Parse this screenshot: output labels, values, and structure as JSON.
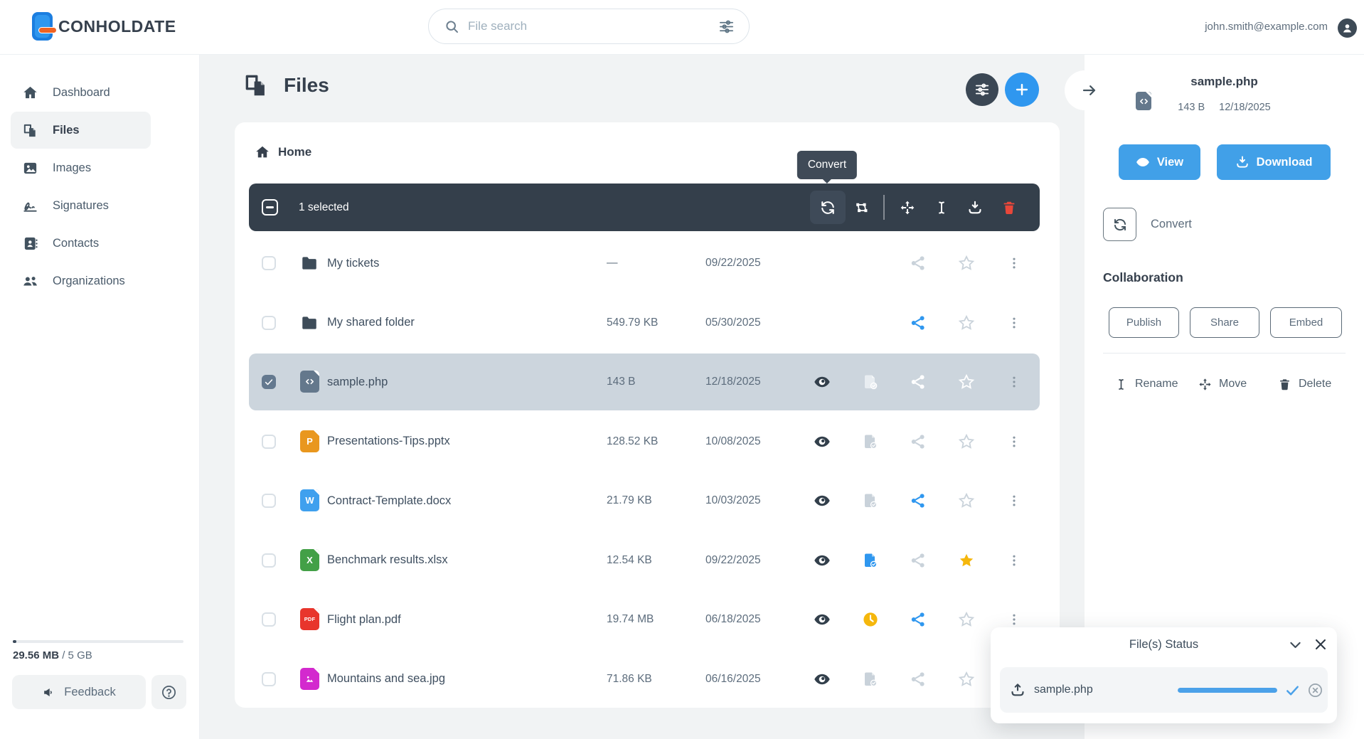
{
  "topbar": {
    "logo_text": "CONHOLDATE",
    "search_placeholder": "File search",
    "user_email": "john.smith@example.com"
  },
  "sidebar": {
    "items": [
      {
        "label": "Dashboard",
        "icon": "home",
        "active": false
      },
      {
        "label": "Files",
        "icon": "files",
        "active": true
      },
      {
        "label": "Images",
        "icon": "image",
        "active": false
      },
      {
        "label": "Signatures",
        "icon": "signature",
        "active": false
      },
      {
        "label": "Contacts",
        "icon": "contacts",
        "active": false
      },
      {
        "label": "Organizations",
        "icon": "organizations",
        "active": false
      }
    ],
    "storage": {
      "used": "29.56 MB",
      "total": "/ 5 GB",
      "used_percent": 2
    },
    "feedback_label": "Feedback"
  },
  "main": {
    "title": "Files",
    "breadcrumb": "Home",
    "toolbar": {
      "selected_text": "1 selected",
      "tooltip": "Convert",
      "icons": [
        "convert",
        "merge",
        "move",
        "rename",
        "download",
        "delete"
      ]
    },
    "files": [
      {
        "name": "My tickets",
        "type": "folder",
        "size": "—",
        "date": "09/22/2025",
        "selected": false,
        "actions": {
          "eye": false,
          "doc": "none",
          "share": "gray",
          "star": "gray"
        }
      },
      {
        "name": "My shared folder",
        "type": "folder",
        "size": "549.79 KB",
        "date": "05/30/2025",
        "selected": false,
        "actions": {
          "eye": false,
          "doc": "none",
          "share": "blue",
          "star": "gray"
        }
      },
      {
        "name": "sample.php",
        "type": "php",
        "size": "143 B",
        "date": "12/18/2025",
        "selected": true,
        "actions": {
          "eye": true,
          "doc": "light",
          "share": "white",
          "star": "white"
        }
      },
      {
        "name": "Presentations-Tips.pptx",
        "type": "pptx",
        "size": "128.52 KB",
        "date": "10/08/2025",
        "selected": false,
        "actions": {
          "eye": true,
          "doc": "gray",
          "share": "gray",
          "star": "gray"
        }
      },
      {
        "name": "Contract-Template.docx",
        "type": "docx",
        "size": "21.79 KB",
        "date": "10/03/2025",
        "selected": false,
        "actions": {
          "eye": true,
          "doc": "gray",
          "share": "blue",
          "star": "gray"
        }
      },
      {
        "name": "Benchmark results.xlsx",
        "type": "xlsx",
        "size": "12.54 KB",
        "date": "09/22/2025",
        "selected": false,
        "actions": {
          "eye": true,
          "doc": "blue",
          "share": "gray",
          "star": "yellow"
        }
      },
      {
        "name": "Flight plan.pdf",
        "type": "pdf",
        "size": "19.74 MB",
        "date": "06/18/2025",
        "selected": false,
        "actions": {
          "eye": true,
          "doc": "clock",
          "share": "blue",
          "star": "gray"
        }
      },
      {
        "name": "Mountains and sea.jpg",
        "type": "jpg",
        "size": "71.86 KB",
        "date": "06/16/2025",
        "selected": false,
        "actions": {
          "eye": true,
          "doc": "gray",
          "share": "gray",
          "star": "gray"
        }
      }
    ]
  },
  "details": {
    "file_name": "sample.php",
    "file_type": "php",
    "file_size": "143 B",
    "file_date": "12/18/2025",
    "view_label": "View",
    "download_label": "Download",
    "convert_label": "Convert",
    "collaboration_title": "Collaboration",
    "collab_buttons": [
      "Publish",
      "Share",
      "Embed"
    ],
    "actions": [
      {
        "label": "Rename",
        "icon": "ibeam"
      },
      {
        "label": "Move",
        "icon": "move"
      },
      {
        "label": "Delete",
        "icon": "trash"
      }
    ]
  },
  "status_panel": {
    "title": "File(s) Status",
    "file_name": "sample.php",
    "progress_percent": 100
  },
  "colors": {
    "accent_blue": "#2f97ef",
    "button_blue": "#41a0e8",
    "dark_slate": "#36404d",
    "toolbar_bg": "#343f4b",
    "selected_row_bg": "#ccd5dd",
    "star_yellow": "#f5b70c",
    "danger_red": "#e8473a",
    "main_bg": "#f1f3f4"
  }
}
